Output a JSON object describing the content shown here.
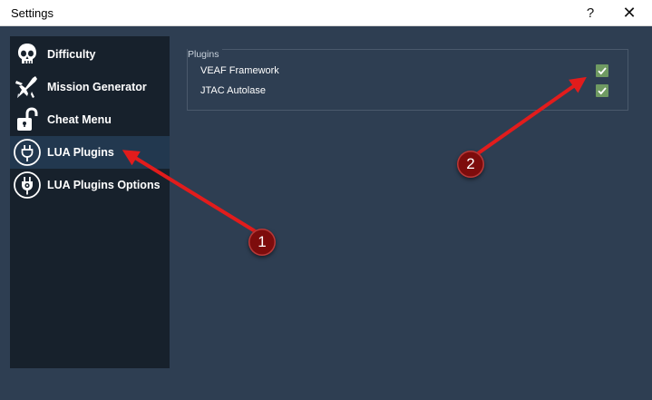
{
  "window": {
    "title": "Settings",
    "help_label": "?",
    "close_label": "✕"
  },
  "sidebar": {
    "items": [
      {
        "label": "Difficulty",
        "icon": "skull-icon",
        "active": false
      },
      {
        "label": "Mission Generator",
        "icon": "fighter-jet-icon",
        "active": false
      },
      {
        "label": "Cheat Menu",
        "icon": "unlocked-padlock-icon",
        "active": false
      },
      {
        "label": "LUA Plugins",
        "icon": "plug-icon",
        "active": true
      },
      {
        "label": "LUA Plugins Options",
        "icon": "plug-settings-icon",
        "active": false
      }
    ]
  },
  "plugins": {
    "group_label": "Plugins",
    "items": [
      {
        "label": "VEAF Framework",
        "checked": true
      },
      {
        "label": "JTAC Autolase",
        "checked": true
      }
    ]
  },
  "annotations": {
    "badge_1": "1",
    "badge_2": "2"
  },
  "colors": {
    "background": "#2e3e52",
    "sidebar": "#17212c",
    "active_item": "#22384f",
    "checkbox": "#6f9a62",
    "annotation_arrow": "#e21c1c",
    "annotation_badge": "#7d0c0c"
  }
}
